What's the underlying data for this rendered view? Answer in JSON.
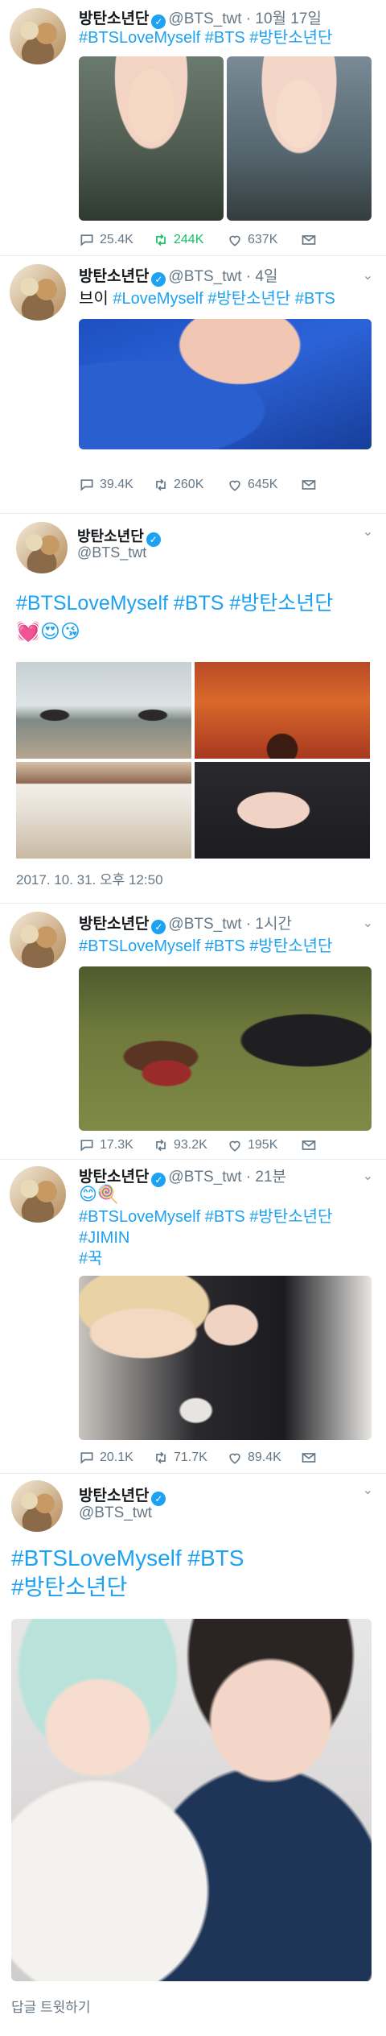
{
  "tweets": [
    {
      "name": "방탄소년단",
      "handle": "@BTS_twt",
      "time": "· 10월 17일",
      "text": "#BTSLoveMyself #BTS #방탄소년단",
      "replies": "25.4K",
      "retweets": "244K",
      "likes": "637K"
    },
    {
      "name": "방탄소년단",
      "handle": "@BTS_twt",
      "time": "· 4일",
      "text_plain": "브이 ",
      "text": "#LoveMyself #방탄소년단 #BTS",
      "replies": "39.4K",
      "retweets": "260K",
      "likes": "645K"
    },
    {
      "name": "방탄소년단",
      "handle": "@BTS_twt",
      "text": "#BTSLoveMyself #BTS #방탄소년단",
      "emoji": "💓😍😘",
      "date": "2017. 10. 31. 오후 12:50"
    },
    {
      "name": "방탄소년단",
      "handle": "@BTS_twt",
      "time": "· 1시간",
      "text": "#BTSLoveMyself #BTS #방탄소년단",
      "replies": "17.3K",
      "retweets": "93.2K",
      "likes": "195K"
    },
    {
      "name": "방탄소년단",
      "handle": "@BTS_twt",
      "time": "· 21분",
      "emoji": "😊🍭",
      "text_line1": "#BTSLoveMyself #BTS #방탄소년단",
      "text_line2": "#JIMIN",
      "text_line3": "#꾹",
      "replies": "20.1K",
      "retweets": "71.7K",
      "likes": "89.4K"
    },
    {
      "name": "방탄소년단",
      "handle": "@BTS_twt",
      "text_line1": "#BTSLoveMyself  #BTS",
      "text_line2": "#방탄소년단",
      "reply_prompt": "답글 트윗하기"
    }
  ]
}
